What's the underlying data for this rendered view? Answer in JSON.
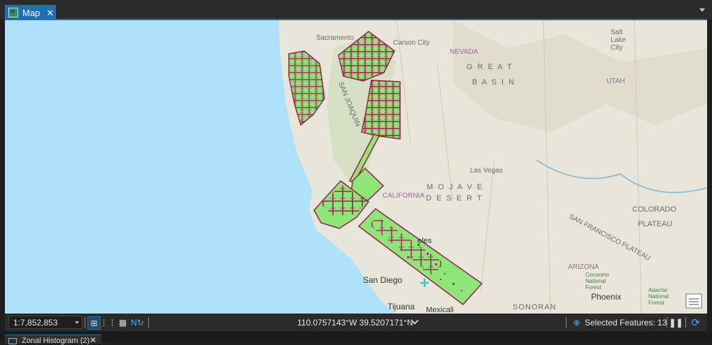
{
  "tab": {
    "title": "Map",
    "close": "✕"
  },
  "map": {
    "labels": {
      "sacramento": "Sacramento",
      "carson_city": "Carson City",
      "nevada": "NEVADA",
      "great": "G R E A T",
      "basin": "B A S I N",
      "salt_lake_1": "Salt",
      "salt_lake_2": "Lake",
      "salt_lake_3": "City",
      "utah": "UTAH",
      "san_joaquin": "SAN JOAQUIN",
      "las_vegas": "Las Vegas",
      "california": "CALIFORNIA",
      "mojave": "M O J A V E",
      "desert": "D E S E R T",
      "colorado": "COLORADO",
      "plateau": "PLATEAU",
      "sf_plateau": "SAN FRANCISCO PLATEAU",
      "arizona": "ARIZONA",
      "coconino_1": "Coconino",
      "coconino_2": "National",
      "coconino_3": "Forest",
      "apache_1": "Apache",
      "apache_2": "National",
      "apache_3": "Forest",
      "phoenix": "Phoenix",
      "san_diego": "San Diego",
      "tijuana": "Tijuana",
      "mexicali": "Mexicali",
      "sonoran": "SONORAN",
      "angeles": "eles"
    }
  },
  "status": {
    "scale": "1:7,852,853",
    "coordinates": "110.0757143°W 39.5207171°N",
    "selected_features": "Selected Features: 13"
  },
  "bottom_tab": {
    "title": "Zonal Histogram (2)",
    "close": "✕"
  },
  "colors": {
    "ocean": "#aee2fa",
    "land": "#e8e6da",
    "polygon_fill": "#8fe678",
    "polygon_stroke": "#9b1d4f",
    "accent": "#1f6fb3"
  },
  "icons": [
    "map-tab-icon",
    "scale-dropdown-icon",
    "snapping-icon",
    "grid-icon",
    "table-icon",
    "north-arrow-icon",
    "chevron-down-icon",
    "selection-icon",
    "pause-icon",
    "refresh-icon",
    "legend-icon",
    "table-tab-icon"
  ]
}
